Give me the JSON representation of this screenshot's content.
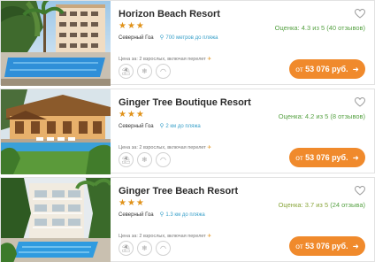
{
  "hotels": [
    {
      "name": "Horizon Beach Resort",
      "stars": "★★★",
      "rating": "Оценка: 4.3 из 5",
      "reviews": "(40 отзывов)",
      "region": "Северный Гоа",
      "distance": "700 метров до пляжа",
      "price_note": "Цена за: 2 взрослых, включая перелет",
      "price_prefix": "от",
      "price": "53 076 руб.",
      "arrow": "➜"
    },
    {
      "name": "Ginger Tree Boutique Resort",
      "stars": "★★★",
      "rating": "Оценка: 4.2 из 5",
      "reviews": "(8 отзывов)",
      "region": "Северный Гоа",
      "distance": "2 км до пляжа",
      "price_note": "Цена за: 2 взрослых, включая перелет",
      "price_prefix": "от",
      "price": "53 076 руб.",
      "arrow": "➜"
    },
    {
      "name": "Ginger Tree Beach Resort",
      "stars": "★★★",
      "rating": "Оценка: 3.7 из 5",
      "reviews": "(24 отзыва)",
      "region": "Северный Гоа",
      "distance": "1.3 км до пляжа",
      "price_note": "Цена за: 2 взрослых, включая перелет",
      "price_prefix": "от",
      "price": "53 076 руб.",
      "arrow": "➜"
    }
  ],
  "amenity_icons": [
    "beach-icon",
    "ac-icon",
    "wifi-icon"
  ],
  "colors": {
    "accent_orange": "#f08a2c",
    "star_gold": "#e0921a",
    "rating_green": "#57a244",
    "link_blue": "#39a0c9"
  }
}
